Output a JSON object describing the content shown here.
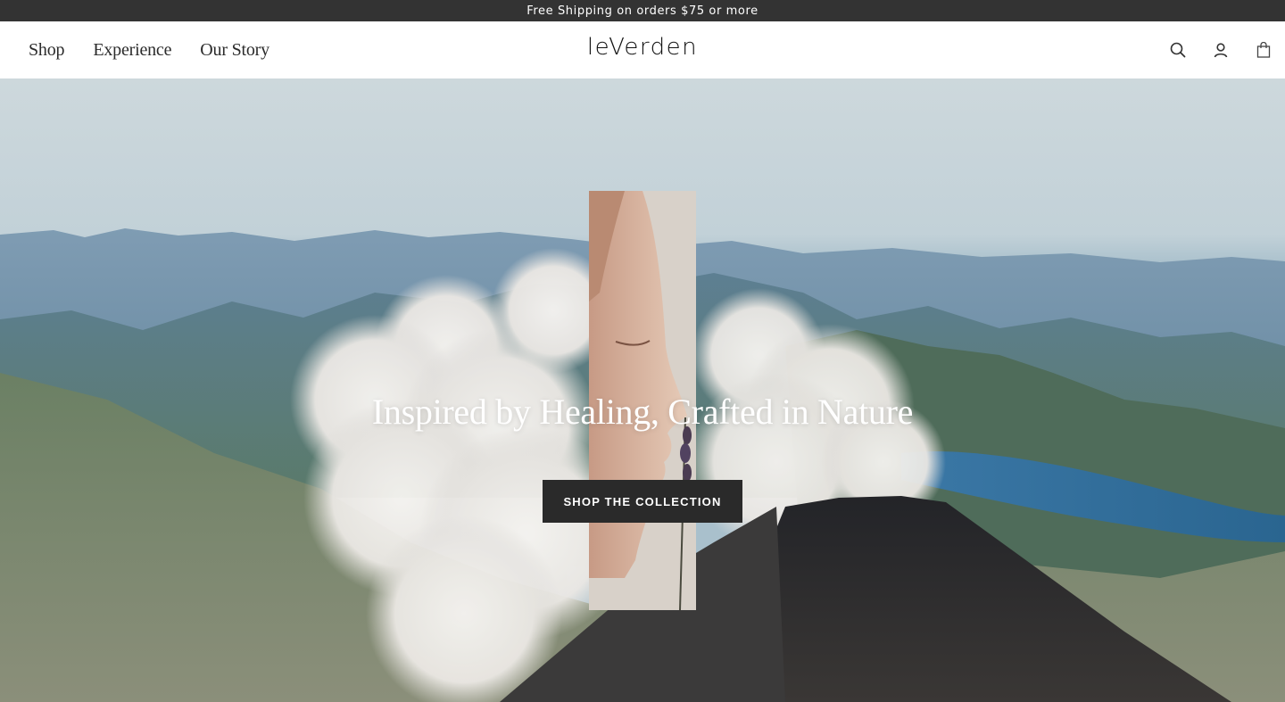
{
  "promo": {
    "text": "Free Shipping on orders $75 or more"
  },
  "nav": {
    "items": [
      "Shop",
      "Experience",
      "Our Story"
    ]
  },
  "brand": {
    "logo_text": "leVerden"
  },
  "header_icons": [
    "search-icon",
    "account-icon",
    "bag-icon"
  ],
  "hero": {
    "title": "Inspired by Healing, Crafted in Nature",
    "cta_label": "SHOP THE COLLECTION"
  },
  "colors": {
    "promo_bg": "#333333",
    "cta_bg": "#2a2a2a",
    "sky": "#c9d6dc",
    "lake": "#2e6c9c",
    "volcano": "#2c2c30"
  }
}
